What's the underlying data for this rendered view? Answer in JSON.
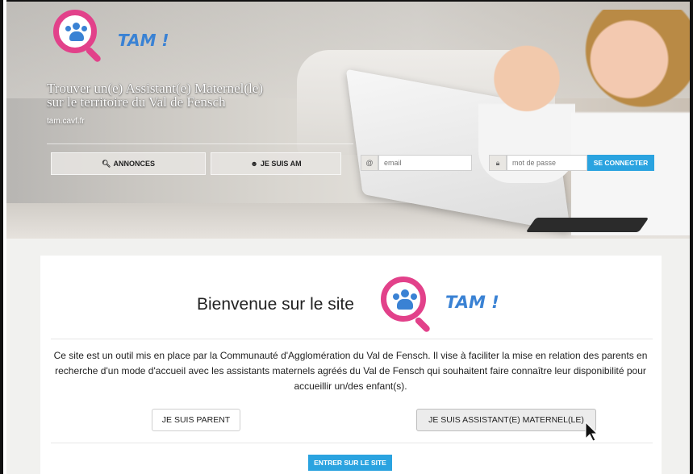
{
  "brand": {
    "logo_text": "TAM !",
    "colors": {
      "pink": "#e2418a",
      "blue": "#3a82d4",
      "primary": "#2aa3e0"
    }
  },
  "hero": {
    "title_line1": "Trouver un(e) Assistant(e) Maternel(le)",
    "title_line2": "sur le territoire du Val de Fensch",
    "domain": "tam.cavf.fr"
  },
  "nav": {
    "annonces_label": "ANNONCES",
    "annonces_icon": "search-icon",
    "je_suis_am_label": "JE SUIS AM",
    "je_suis_am_icon": "user-icon"
  },
  "login": {
    "email_addon": "@",
    "email_placeholder": "email",
    "password_icon": "lock-icon",
    "password_placeholder": "mot de passe",
    "submit_label": "SE CONNECTER"
  },
  "welcome": {
    "heading": "Bienvenue sur le site",
    "intro": "Ce site est un outil mis en place par la Communauté d'Agglomération du Val de Fensch. Il vise à faciliter la mise en relation des parents en recherche d'un mode d'accueil avec les assistants maternels agréés du Val de Fensch qui souhaitent faire connaître leur disponibilité pour accueillir un/des enfant(s).",
    "parent_button": "JE SUIS PARENT",
    "am_button": "JE SUIS ASSISTANT(E) MATERNEL(LE)",
    "enter_button": "ENTRER SUR LE SITE"
  }
}
